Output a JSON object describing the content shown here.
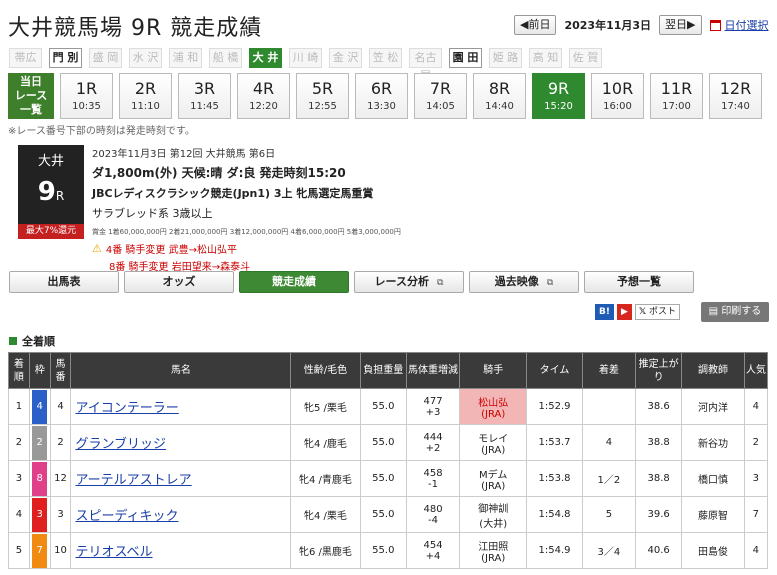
{
  "header": {
    "title": "大井競馬場 9R 競走成績",
    "prev": "◀前日",
    "date": "2023年11月3日",
    "next": "翌日▶",
    "calendar": "日付選択"
  },
  "venues": [
    {
      "label": "帯広",
      "state": "off"
    },
    {
      "label": "門 別",
      "state": "on"
    },
    {
      "label": "盛 岡",
      "state": "off"
    },
    {
      "label": "水 沢",
      "state": "off"
    },
    {
      "label": "浦 和",
      "state": "off"
    },
    {
      "label": "船 橋",
      "state": "off"
    },
    {
      "label": "大 井",
      "state": "cur"
    },
    {
      "label": "川 崎",
      "state": "off"
    },
    {
      "label": "金 沢",
      "state": "off"
    },
    {
      "label": "笠 松",
      "state": "off"
    },
    {
      "label": "名古屋",
      "state": "off"
    },
    {
      "label": "園 田",
      "state": "on"
    },
    {
      "label": "姫 路",
      "state": "off"
    },
    {
      "label": "高 知",
      "state": "off"
    },
    {
      "label": "佐 賀",
      "state": "off"
    }
  ],
  "race_first": "当日\nレース\n一覧",
  "races": [
    {
      "n": "1R",
      "t": "10:35"
    },
    {
      "n": "2R",
      "t": "11:10"
    },
    {
      "n": "3R",
      "t": "11:45"
    },
    {
      "n": "4R",
      "t": "12:20"
    },
    {
      "n": "5R",
      "t": "12:55"
    },
    {
      "n": "6R",
      "t": "13:30"
    },
    {
      "n": "7R",
      "t": "14:05"
    },
    {
      "n": "8R",
      "t": "14:40"
    },
    {
      "n": "9R",
      "t": "15:20",
      "cur": true
    },
    {
      "n": "10R",
      "t": "16:00"
    },
    {
      "n": "11R",
      "t": "17:00"
    },
    {
      "n": "12R",
      "t": "17:40"
    }
  ],
  "race_note": "※レース番号下部の時刻は発走時刻です。",
  "race_box": {
    "venue": "大井",
    "num": "9",
    "unit": "R",
    "max": "最大7%還元"
  },
  "info": {
    "line1": "2023年11月3日 第12回 大井競馬 第6日",
    "line2": "ダ1,800m(外) 天候:晴 ダ:良 発走時刻15:20",
    "line3": "JBCレディスクラシック競走(Jpn1) 3上 牝馬選定馬重賞",
    "line4": "サラブレッド系 3歳以上",
    "prize": "賞金 1着60,000,000円 2着21,000,000円 3着12,000,000円 4着6,000,000円 5着3,000,000円",
    "change1": "4番 騎手変更 武豊→松山弘平",
    "change2": "8番 騎手変更 岩田望来→森泰斗"
  },
  "tabs": [
    {
      "label": "出馬表"
    },
    {
      "label": "オッズ"
    },
    {
      "label": "競走成績",
      "cur": true
    },
    {
      "label": "レース分析",
      "ext": true
    },
    {
      "label": "過去映像",
      "ext": true
    },
    {
      "label": "予想一覧"
    }
  ],
  "social": {
    "b": "B!",
    "x": "ポスト",
    "print": "印刷する"
  },
  "section": "全着順",
  "table_headers": [
    "着順",
    "枠",
    "馬番",
    "馬名",
    "性齢/毛色",
    "負担重量",
    "馬体重増減",
    "騎手",
    "タイム",
    "着差",
    "推定上がり",
    "調教師",
    "人気"
  ],
  "rows": [
    {
      "pos": "1",
      "waku": "4",
      "num": "4",
      "name": "アイコンテーラー",
      "sex": "牝5 /栗毛",
      "wt": "55.0",
      "bw": "477",
      "bwd": "+3",
      "jk": "松山弘",
      "jkb": "(JRA)",
      "time": "1:52.9",
      "diff": "",
      "up": "38.6",
      "tr": "河内洋",
      "pop": "4",
      "hl": true,
      "wc": "#2a60c8"
    },
    {
      "pos": "2",
      "waku": "2",
      "num": "2",
      "name": "グランブリッジ",
      "sex": "牝4 /鹿毛",
      "wt": "55.0",
      "bw": "444",
      "bwd": "+2",
      "jk": "モレイ",
      "jkb": "(JRA)",
      "time": "1:53.7",
      "diff": "4",
      "up": "38.8",
      "tr": "新谷功",
      "pop": "2",
      "hl": false,
      "wc": "#999999"
    },
    {
      "pos": "3",
      "waku": "8",
      "num": "12",
      "name": "アーテルアストレア",
      "sex": "牝4 /青鹿毛",
      "wt": "55.0",
      "bw": "458",
      "bwd": "-1",
      "jk": "Mデム",
      "jkb": "(JRA)",
      "time": "1:53.8",
      "diff": "1／2",
      "up": "38.8",
      "tr": "橋口慎",
      "pop": "3",
      "hl": false,
      "wc": "#e0408a"
    },
    {
      "pos": "4",
      "waku": "3",
      "num": "3",
      "name": "スピーディキック",
      "sex": "牝4 /栗毛",
      "wt": "55.0",
      "bw": "480",
      "bwd": "-4",
      "jk": "御神訓",
      "jkb": "(大井)",
      "time": "1:54.8",
      "diff": "5",
      "up": "39.6",
      "tr": "藤原智",
      "pop": "7",
      "hl": false,
      "wc": "#e02020"
    },
    {
      "pos": "5",
      "waku": "7",
      "num": "10",
      "name": "テリオスベル",
      "sex": "牝6 /黒鹿毛",
      "wt": "55.0",
      "bw": "454",
      "bwd": "+4",
      "jk": "江田照",
      "jkb": "(JRA)",
      "time": "1:54.9",
      "diff": "3／4",
      "up": "40.6",
      "tr": "田島俊",
      "pop": "4",
      "hl": false,
      "wc": "#f08a10"
    }
  ]
}
